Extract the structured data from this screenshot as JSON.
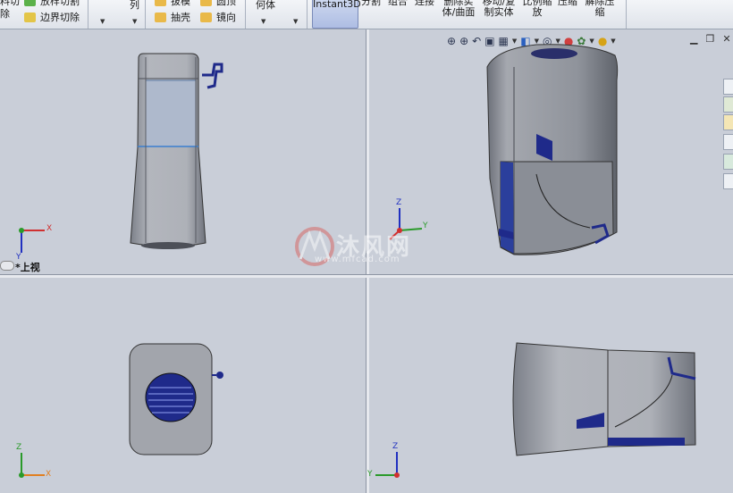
{
  "ribbon": {
    "col1": [
      "料切",
      "除"
    ],
    "col2": [
      "放样切割",
      "边界切除"
    ],
    "col3": [
      "列"
    ],
    "col4": [
      "拔模",
      "抽壳"
    ],
    "col5": [
      "圆顶",
      "镜向"
    ],
    "col6": [
      "何体"
    ],
    "instant3d": "Instant3D",
    "tail_labels": [
      "分割",
      "组合",
      "连接",
      "删除实体/曲面",
      "移动/复制实体",
      "比例缩放",
      "压缩",
      "解除压缩"
    ]
  },
  "viewport": {
    "view_label": "*上视",
    "triad_labels": {
      "x": "X",
      "y": "Y",
      "z": "Z"
    }
  },
  "watermark": {
    "brand": "沐风网",
    "url": "www.mfcad.com"
  },
  "colors": {
    "accent": "#1f2a8a",
    "body_gray": "#9ea2ab",
    "pane": "#c9ced8"
  }
}
